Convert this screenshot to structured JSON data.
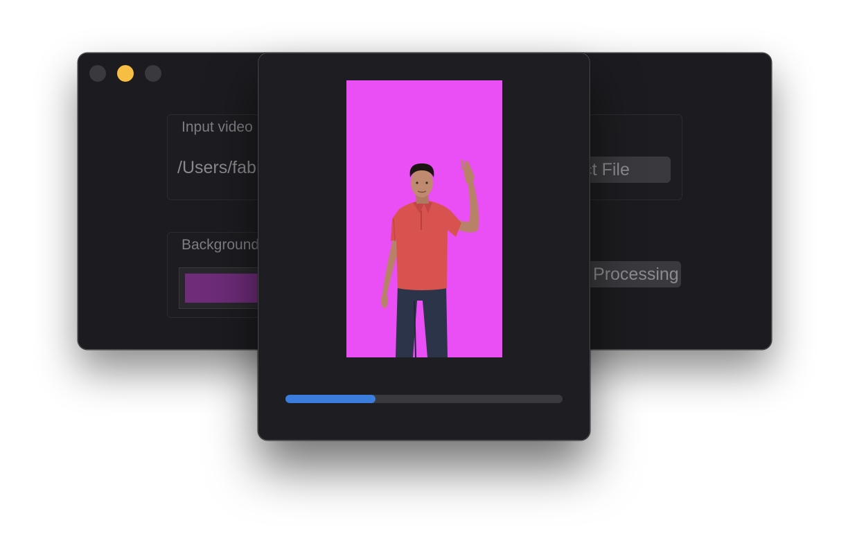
{
  "main_window": {
    "traffic_lights": [
      "close",
      "minimize",
      "zoom"
    ],
    "input_group": {
      "title": "Input video",
      "path": "/Users/fabio/Desktop/video.mov",
      "select_button_label": "Select File"
    },
    "background_group": {
      "title": "Background color",
      "color": "#6e2c79"
    },
    "process_button_label": "Start Processing"
  },
  "preview_window": {
    "video": {
      "background_color": "#e94ff4",
      "subject": "person-raising-hand"
    },
    "progress": {
      "fraction": 0.325,
      "color": "#3b7ddd"
    }
  }
}
